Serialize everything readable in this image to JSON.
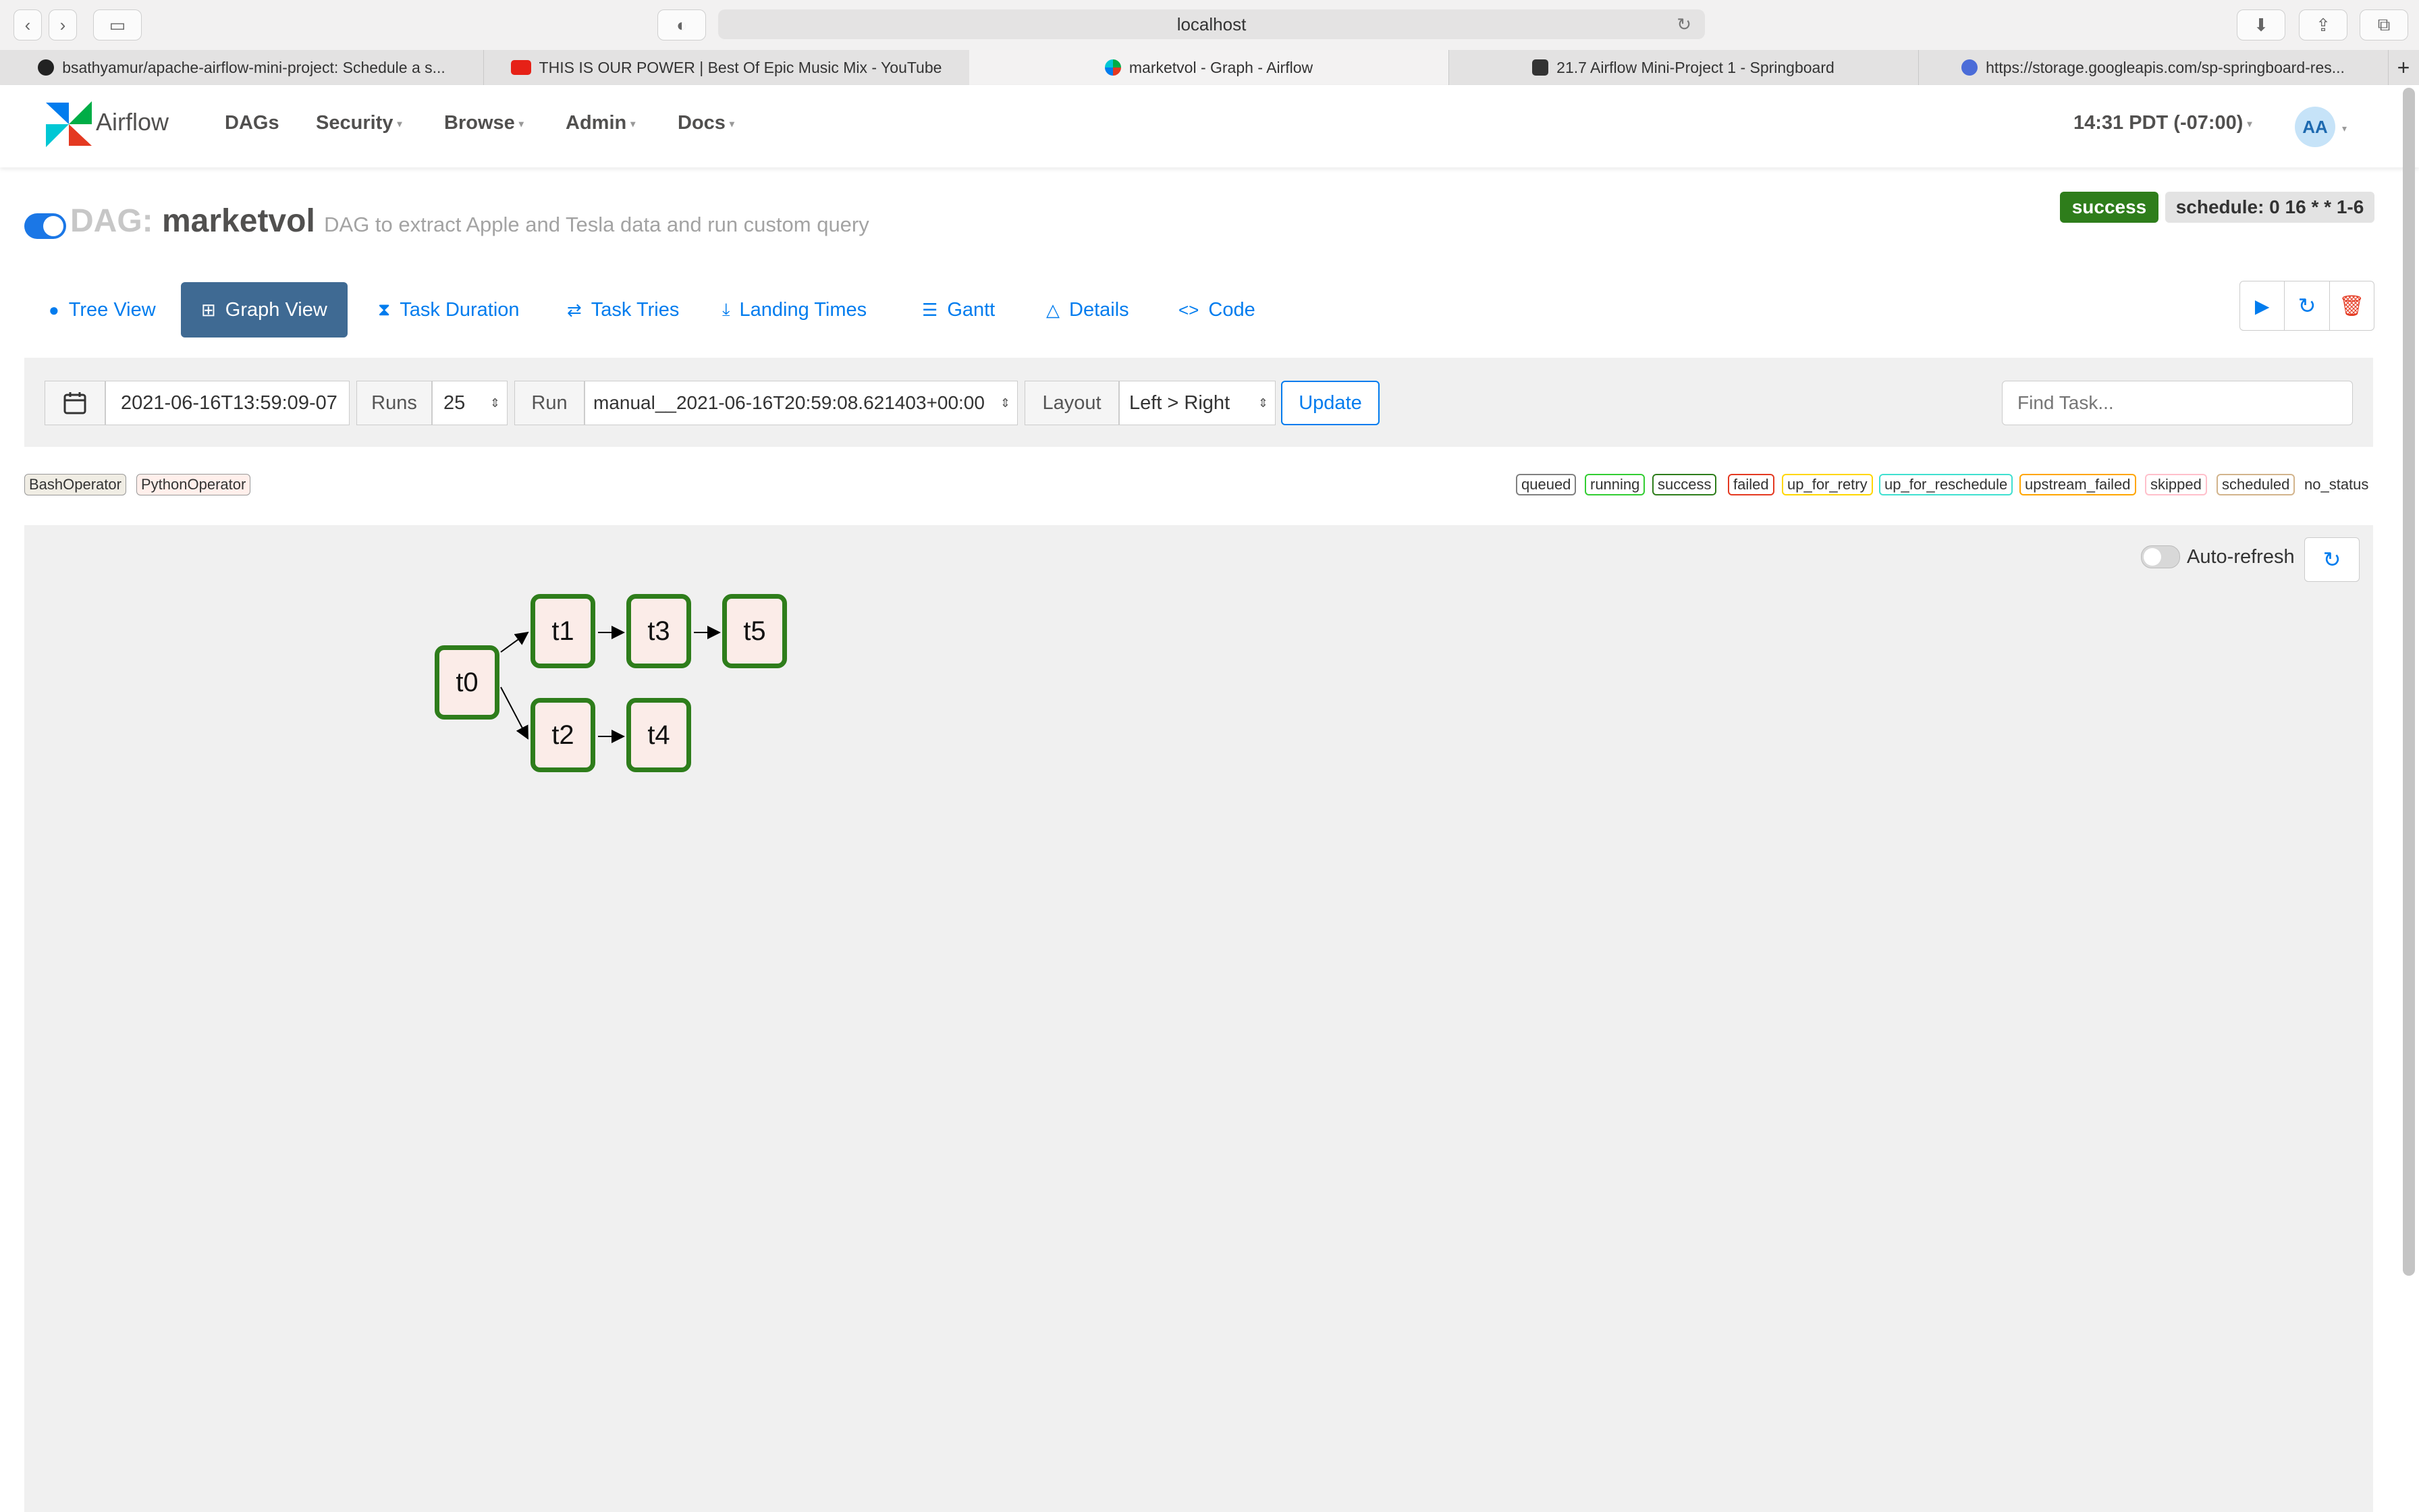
{
  "browser": {
    "url": "localhost",
    "tabs": [
      {
        "label": "bsathyamur/apache-airflow-mini-project: Schedule a s..."
      },
      {
        "label": "THIS IS OUR POWER | Best Of Epic Music Mix - YouTube"
      },
      {
        "label": "marketvol - Graph - Airflow"
      },
      {
        "label": "21.7 Airflow Mini-Project 1 - Springboard"
      },
      {
        "label": "https://storage.googleapis.com/sp-springboard-res..."
      }
    ]
  },
  "navbar": {
    "brand": "Airflow",
    "menu": [
      "DAGs",
      "Security",
      "Browse",
      "Admin",
      "Docs"
    ],
    "time": "14:31 PDT (-07:00)",
    "user_initials": "AA"
  },
  "dag": {
    "prefix": "DAG:",
    "name": "marketvol",
    "description": "DAG to extract Apple and Tesla data and run custom query",
    "status": "success",
    "schedule": "schedule: 0 16 * * 1-6"
  },
  "view_tabs": [
    "Tree View",
    "Graph View",
    "Task Duration",
    "Task Tries",
    "Landing Times",
    "Gantt",
    "Details",
    "Code"
  ],
  "filter": {
    "date": "2021-06-16T13:59:09-07",
    "runs_label": "Runs",
    "runs_value": "25",
    "run_label": "Run",
    "run_value": "manual__2021-06-16T20:59:08.621403+00:00",
    "layout_label": "Layout",
    "layout_value": "Left > Right",
    "update_label": "Update",
    "find_placeholder": "Find Task..."
  },
  "operators": [
    "BashOperator",
    "PythonOperator"
  ],
  "states": [
    "queued",
    "running",
    "success",
    "failed",
    "up_for_retry",
    "up_for_reschedule",
    "upstream_failed",
    "skipped",
    "scheduled",
    "no_status"
  ],
  "graph": {
    "auto_refresh_label": "Auto-refresh",
    "nodes": [
      "t0",
      "t1",
      "t2",
      "t3",
      "t4",
      "t5"
    ],
    "node_state": "success",
    "node_border_color": "#2e7d1b",
    "node_fill_color": "#fbece8"
  },
  "colors": {
    "accent": "#017cee",
    "active_tab": "#3f6a93",
    "success": "#2e7d1b"
  }
}
